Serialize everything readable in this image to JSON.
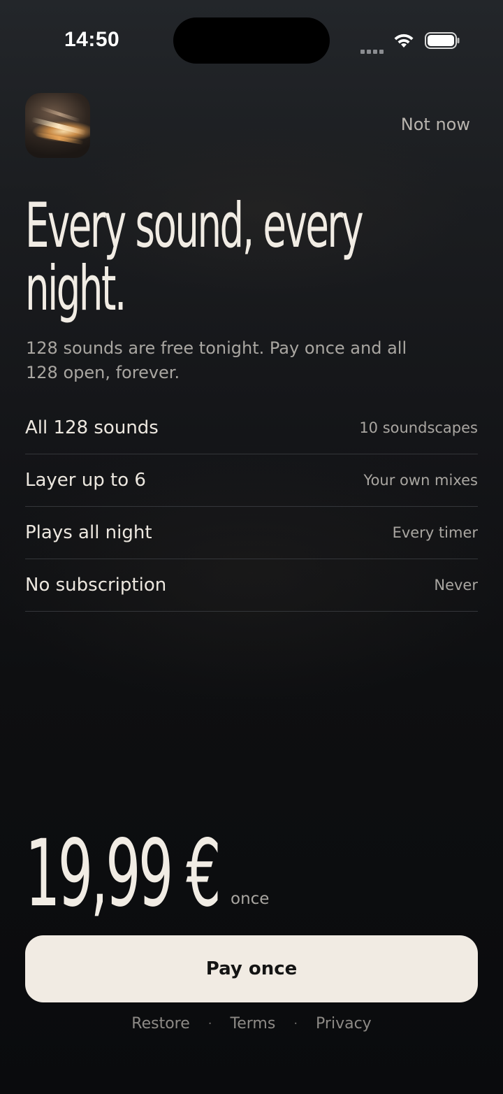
{
  "status_bar": {
    "time": "14:50"
  },
  "header": {
    "app_icon": "app-artwork-icon",
    "dismiss_label": "Not now"
  },
  "hero": {
    "headline": "Every sound, every night.",
    "subhead": "128 sounds are free tonight. Pay once and all 128 open, forever."
  },
  "features": [
    {
      "title": "All 128 sounds",
      "detail": "10 soundscapes"
    },
    {
      "title": "Layer up to 6",
      "detail": "Your own mixes"
    },
    {
      "title": "Plays all night",
      "detail": "Every timer"
    },
    {
      "title": "No subscription",
      "detail": "Never"
    }
  ],
  "pricing": {
    "price": "19,99 €",
    "suffix": "once"
  },
  "cta": {
    "label": "Pay once"
  },
  "footer": {
    "links": [
      "Restore",
      "Terms",
      "Privacy"
    ],
    "separator": "·"
  },
  "colors": {
    "background_top": "#23262a",
    "background_bottom": "#0a0b0d",
    "text_primary": "#f1ece4",
    "text_secondary": "#a9a6a1",
    "button_background": "#f1ebe3",
    "button_text": "#141414",
    "divider": "#34363a"
  }
}
